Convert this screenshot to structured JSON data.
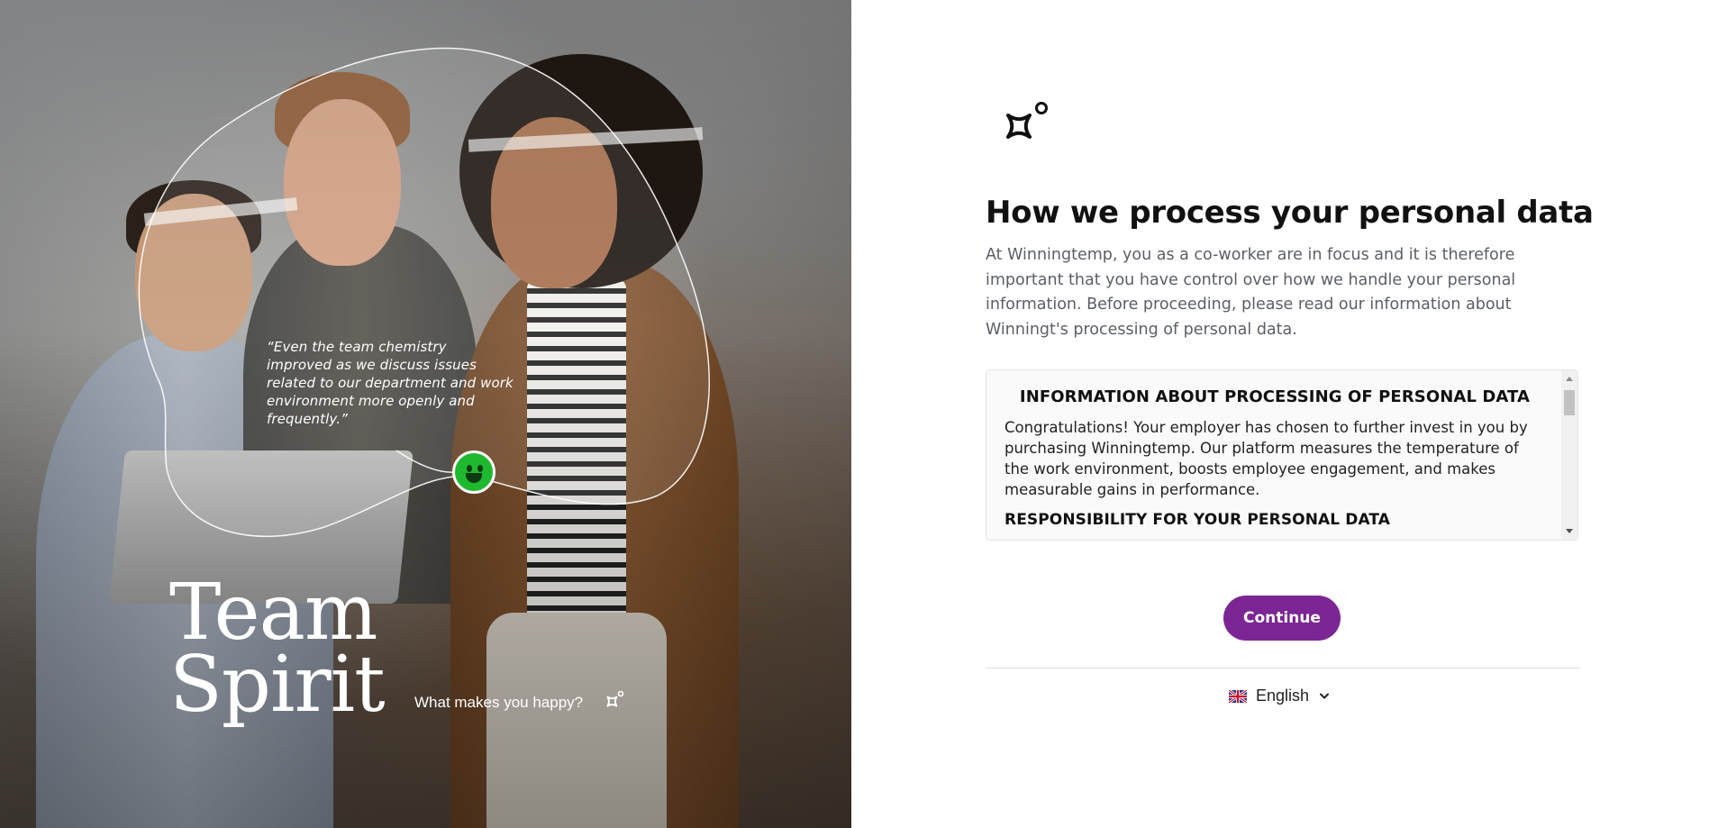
{
  "hero": {
    "quote": "“Even the team chemistry improved as we discuss issues related to our department and work environment more openly and frequently.”",
    "title_line1": "Team",
    "title_line2": "Spirit",
    "tagline": "What makes you happy?",
    "smiley_color": "#1fb82f"
  },
  "main": {
    "title": "How we process your personal data",
    "intro": "At Winningtemp, you as a co-worker are in focus and it is therefore important that you have control over how we handle your personal information. Before proceeding, please read our information about Winningt's processing of personal data.",
    "terms": {
      "heading": "INFORMATION ABOUT PROCESSING OF PERSONAL DATA",
      "paragraph": "Congratulations! Your employer has chosen to further invest in you by purchasing Winningtemp. Our platform measures the temperature of the work environment, boosts employee engagement, and makes measurable gains in performance.",
      "subheading": "RESPONSIBILITY FOR YOUR PERSONAL DATA"
    },
    "continue_label": "Continue",
    "language": {
      "selected": "English",
      "flag_icon": "uk-flag-icon"
    }
  },
  "colors": {
    "accent": "#7b2694",
    "heading": "#111111",
    "body_text": "#5a5f66"
  }
}
